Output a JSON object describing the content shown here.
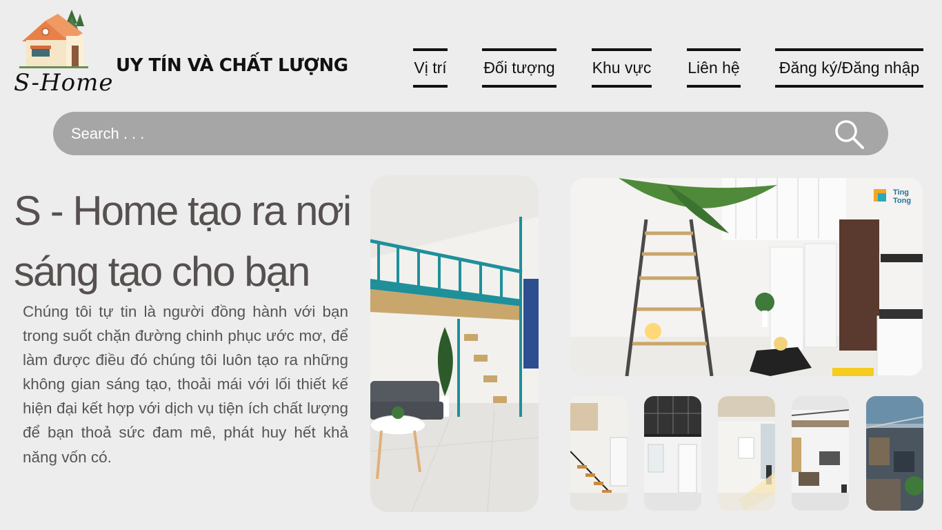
{
  "header": {
    "logo_text": "S-Home",
    "tagline": "UY TÍN VÀ CHẤT LƯỢNG"
  },
  "nav": {
    "items": [
      {
        "label": "Vị trí"
      },
      {
        "label": "Đối tượng"
      },
      {
        "label": "Khu vực"
      },
      {
        "label": "Liên hệ"
      },
      {
        "label": "Đăng ký/Đăng nhập"
      }
    ]
  },
  "search": {
    "placeholder": "Search . . .",
    "icon": "search-icon"
  },
  "hero": {
    "title": "S - Home tạo ra nơi sáng tạo cho bạn",
    "body": "Chúng tôi tự tin là người đồng hành với bạn trong suốt chặn đường chinh phục ước mơ, để làm được điều đó chúng tôi luôn tạo ra những không gian sáng tạo, thoải mái với lối thiết kế hiện đại kết hợp với dịch vụ tiện ích chất lượng để bạn thoả sức đam mê, phát huy hết khả năng vốn có."
  },
  "gallery": {
    "watermark": "Ting Tong"
  },
  "colors": {
    "background": "#ededed",
    "search_bg": "#a6a6a6",
    "title": "#565150",
    "loft_teal": "#1f8f9a"
  }
}
